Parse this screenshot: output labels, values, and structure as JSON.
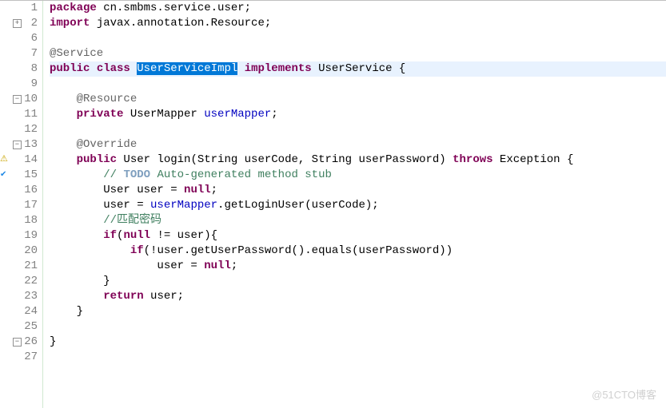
{
  "lines": [
    {
      "num": "1",
      "fold": "",
      "marker": ""
    },
    {
      "num": "2",
      "fold": "plus",
      "marker": ""
    },
    {
      "num": "6",
      "fold": "",
      "marker": ""
    },
    {
      "num": "7",
      "fold": "",
      "marker": ""
    },
    {
      "num": "8",
      "fold": "",
      "marker": ""
    },
    {
      "num": "9",
      "fold": "",
      "marker": ""
    },
    {
      "num": "10",
      "fold": "minus",
      "marker": ""
    },
    {
      "num": "11",
      "fold": "",
      "marker": ""
    },
    {
      "num": "12",
      "fold": "",
      "marker": ""
    },
    {
      "num": "13",
      "fold": "minus",
      "marker": ""
    },
    {
      "num": "14",
      "fold": "",
      "marker": "warn"
    },
    {
      "num": "15",
      "fold": "",
      "marker": "ok"
    },
    {
      "num": "16",
      "fold": "",
      "marker": ""
    },
    {
      "num": "17",
      "fold": "",
      "marker": ""
    },
    {
      "num": "18",
      "fold": "",
      "marker": ""
    },
    {
      "num": "19",
      "fold": "",
      "marker": ""
    },
    {
      "num": "20",
      "fold": "",
      "marker": ""
    },
    {
      "num": "21",
      "fold": "",
      "marker": ""
    },
    {
      "num": "22",
      "fold": "",
      "marker": ""
    },
    {
      "num": "23",
      "fold": "",
      "marker": ""
    },
    {
      "num": "24",
      "fold": "",
      "marker": ""
    },
    {
      "num": "25",
      "fold": "",
      "marker": ""
    },
    {
      "num": "26",
      "fold": "minus",
      "marker": ""
    },
    {
      "num": "27",
      "fold": "",
      "marker": ""
    }
  ],
  "code": {
    "l1": {
      "kw_package": "package",
      "pkg": " cn.smbms.service.user;"
    },
    "l2": {
      "kw_import": "import",
      "imp": " javax.annotation.Resource;"
    },
    "l7": {
      "ann": "@Service"
    },
    "l8": {
      "kw_public": "public",
      "kw_class": "class",
      "sel": "UserServiceImpl",
      "kw_impl": "implements",
      "iface": " UserService {"
    },
    "l10": {
      "ann": "@Resource"
    },
    "l11": {
      "kw_private": "private",
      "type": " UserMapper ",
      "field": "userMapper",
      "semi": ";"
    },
    "l13": {
      "ann": "@Override"
    },
    "l14": {
      "kw_public": "public",
      "ret": " User login(String userCode, String userPassword) ",
      "kw_throws": "throws",
      "exc": " Exception {"
    },
    "l15": {
      "c1": "// ",
      "todo": "TODO",
      "c2": " Auto-generated method stub"
    },
    "l16": {
      "txt1": "User user = ",
      "kw_null": "null",
      "semi": ";"
    },
    "l17": {
      "txt1": "user = ",
      "field": "userMapper",
      "txt2": ".getLoginUser(userCode);"
    },
    "l18": {
      "comment": "//匹配密码"
    },
    "l19": {
      "kw_if": "if",
      "open": "(",
      "kw_null": "null",
      "rest": " != user){"
    },
    "l20": {
      "kw_if": "if",
      "rest": "(!user.getUserPassword().equals(userPassword))"
    },
    "l21": {
      "txt1": "user = ",
      "kw_null": "null",
      "semi": ";"
    },
    "l22": {
      "brace": "}"
    },
    "l23": {
      "kw_return": "return",
      "rest": " user;"
    },
    "l24": {
      "brace": "}"
    },
    "l26": {
      "brace": "}"
    }
  },
  "watermark": "@51CTO博客"
}
